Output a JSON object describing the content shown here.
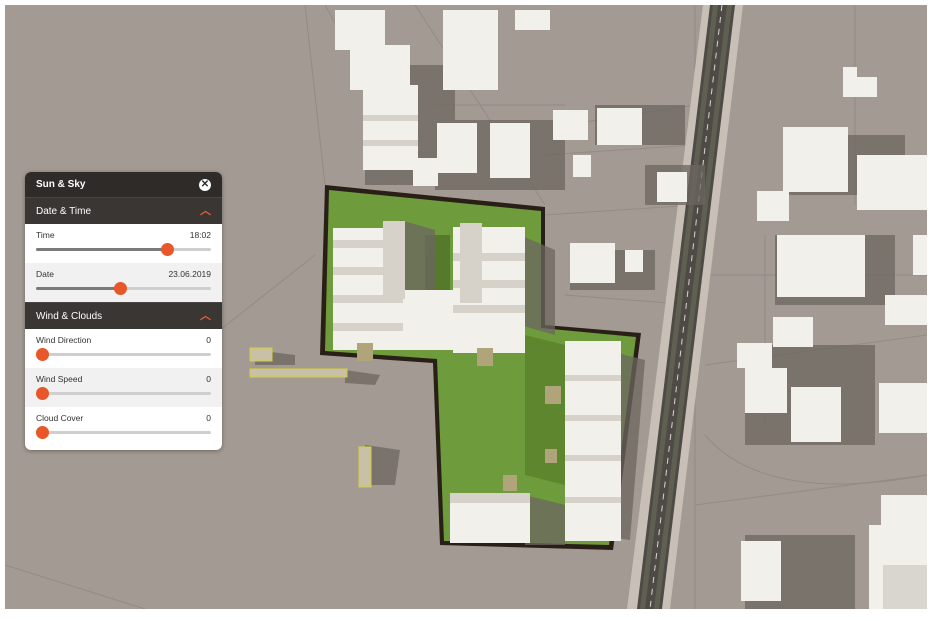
{
  "panel": {
    "title": "Sun & Sky",
    "close_icon": "close-icon",
    "sections": [
      {
        "title": "Date & Time",
        "chevron_icon": "chevron-up-icon",
        "rows": [
          {
            "label": "Time",
            "value": "18:02",
            "fraction": 0.75
          },
          {
            "label": "Date",
            "value": "23.06.2019",
            "fraction": 0.48
          }
        ]
      },
      {
        "title": "Wind & Clouds",
        "chevron_icon": "chevron-up-icon",
        "rows": [
          {
            "label": "Wind Direction",
            "value": "0",
            "fraction": 0
          },
          {
            "label": "Wind Speed",
            "value": "0",
            "fraction": 0
          },
          {
            "label": "Cloud Cover",
            "value": "0",
            "fraction": 0
          }
        ]
      }
    ]
  },
  "colors": {
    "accent": "#e8572a",
    "ground": "#a29a93",
    "site": "#6f9a3c",
    "header": "#2f2b29"
  }
}
